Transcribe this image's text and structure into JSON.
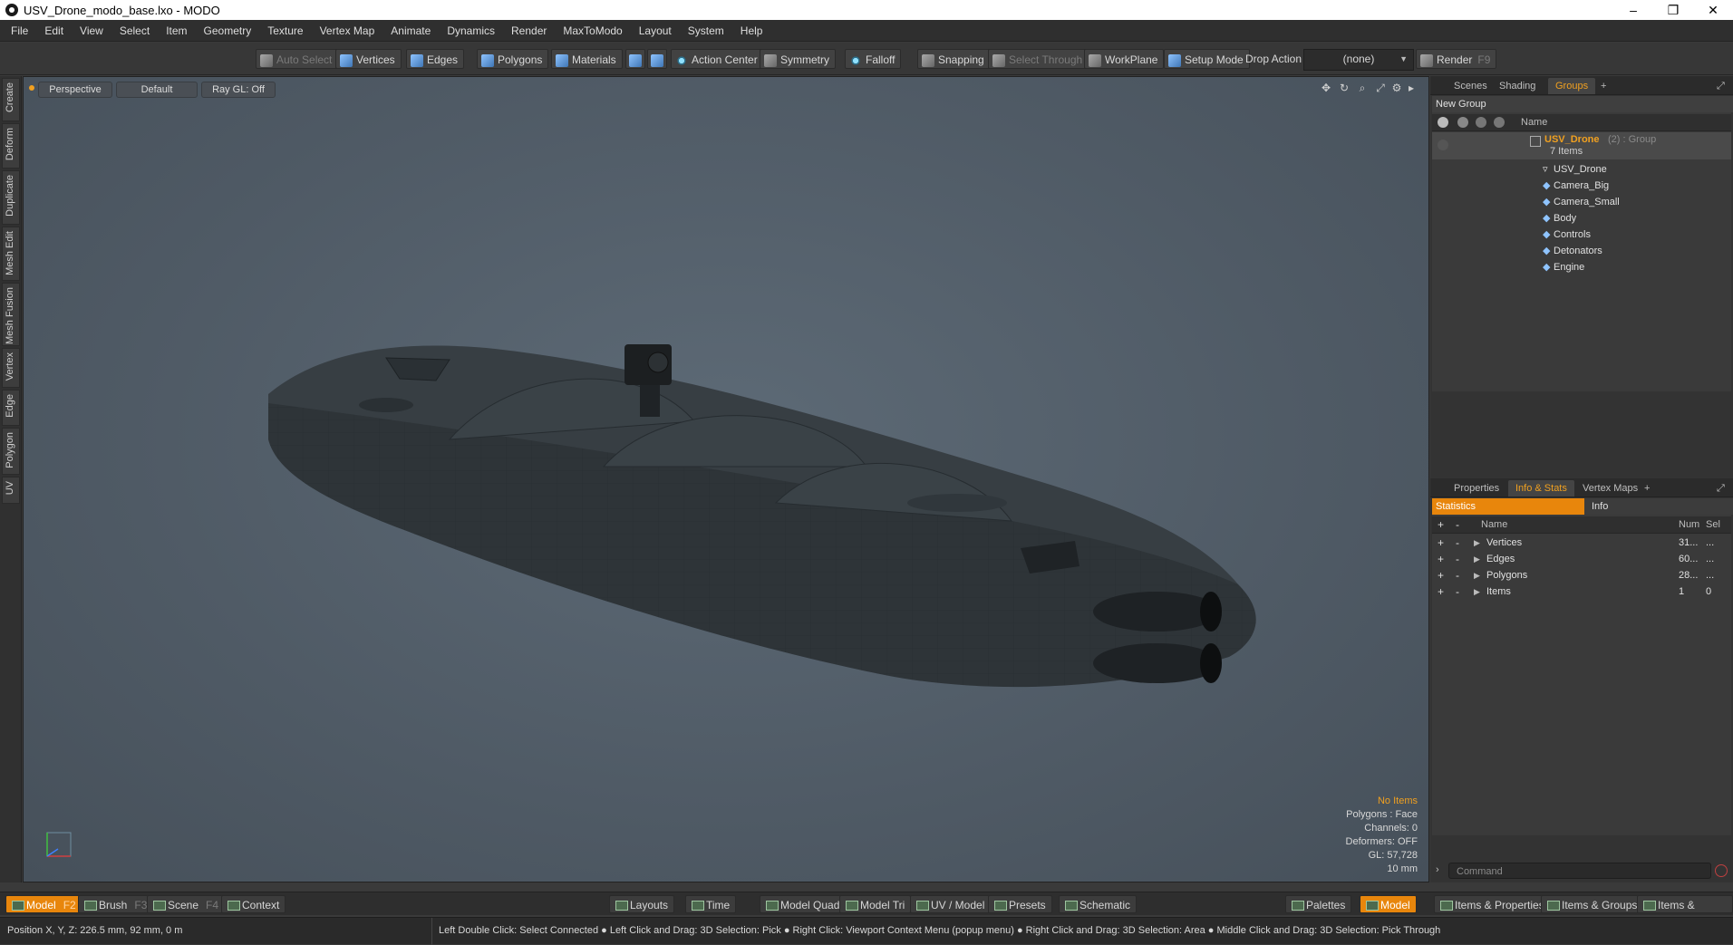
{
  "window": {
    "title": "USV_Drone_modo_base.lxo - MODO",
    "controls": [
      "–",
      "❐",
      "✕"
    ]
  },
  "menu": [
    "File",
    "Edit",
    "View",
    "Select",
    "Item",
    "Geometry",
    "Texture",
    "Vertex Map",
    "Animate",
    "Dynamics",
    "Render",
    "MaxToModo",
    "Layout",
    "System",
    "Help"
  ],
  "toolbar": {
    "auto_select": "Auto Select",
    "vertices": "Vertices",
    "edges": "Edges",
    "polygons": "Polygons",
    "materials": "Materials",
    "action_center": "Action Center",
    "symmetry": "Symmetry",
    "falloff": "Falloff",
    "snapping": "Snapping",
    "select_through": "Select Through",
    "workplane": "WorkPlane",
    "setup_mode": "Setup Mode",
    "drop_action_label": "Drop Action",
    "drop_action_value": "(none)",
    "render": "Render",
    "render_key": "F9"
  },
  "left_tabs": [
    "Create",
    "Deform",
    "Duplicate",
    "Mesh Edit",
    "Mesh Fusion",
    "Vertex",
    "Edge",
    "Polygon",
    "UV"
  ],
  "viewport": {
    "view_mode": "Perspective",
    "shading": "Default",
    "raygl": "Ray GL: Off",
    "stats": {
      "items": "No Items",
      "polygons": "Polygons : Face",
      "channels": "Channels: 0",
      "deformers": "Deformers: OFF",
      "gl": "GL: 57,728",
      "scale": "10 mm"
    }
  },
  "groups_panel": {
    "tabs": [
      "Scenes",
      "Shading",
      "Groups",
      "+"
    ],
    "new_group": "New Group",
    "name_header": "Name",
    "group_name": "USV_Drone",
    "group_suffix": "(2) : Group",
    "group_count": "7 Items",
    "items": [
      "USV_Drone",
      "Camera_Big",
      "Camera_Small",
      "Body",
      "Controls",
      "Detonators",
      "Engine"
    ]
  },
  "info_panel": {
    "tabs": [
      "Properties",
      "Info & Stats",
      "Vertex Maps",
      "+"
    ],
    "subtabs": [
      "Statistics",
      "Info"
    ],
    "headers": {
      "name": "Name",
      "num": "Num",
      "sel": "Sel"
    },
    "rows": [
      {
        "name": "Vertices",
        "num": "31...",
        "sel": "..."
      },
      {
        "name": "Edges",
        "num": "60...",
        "sel": "..."
      },
      {
        "name": "Polygons",
        "num": "28...",
        "sel": "..."
      },
      {
        "name": "Items",
        "num": "1",
        "sel": "0"
      }
    ],
    "command_placeholder": "Command"
  },
  "bottom_tabs": {
    "model": "Model",
    "model_key": "F2",
    "brush": "Brush",
    "brush_key": "F3",
    "scene": "Scene",
    "scene_key": "F4",
    "context": "Context",
    "layouts": "Layouts",
    "time": "Time",
    "model_quad": "Model Quad",
    "model_tri": "Model Tri",
    "uv_model": "UV / Model",
    "presets": "Presets",
    "schematic": "Schematic",
    "palettes": "Palettes",
    "model_right": "Model",
    "items_props": "Items & Properties",
    "items_groups": "Items & Groups",
    "items_shading": "Items & Shading"
  },
  "status": {
    "position": "Position X, Y, Z:   226.5 mm, 92 mm, 0 m",
    "hints": "Left Double Click: Select Connected ● Left Click and Drag: 3D Selection: Pick ● Right Click: Viewport Context Menu (popup menu) ● Right Click and Drag: 3D Selection: Area ● Middle Click and Drag: 3D Selection: Pick Through"
  },
  "colors": {
    "accent": "#f0a020",
    "active_tab": "#e8860c"
  }
}
